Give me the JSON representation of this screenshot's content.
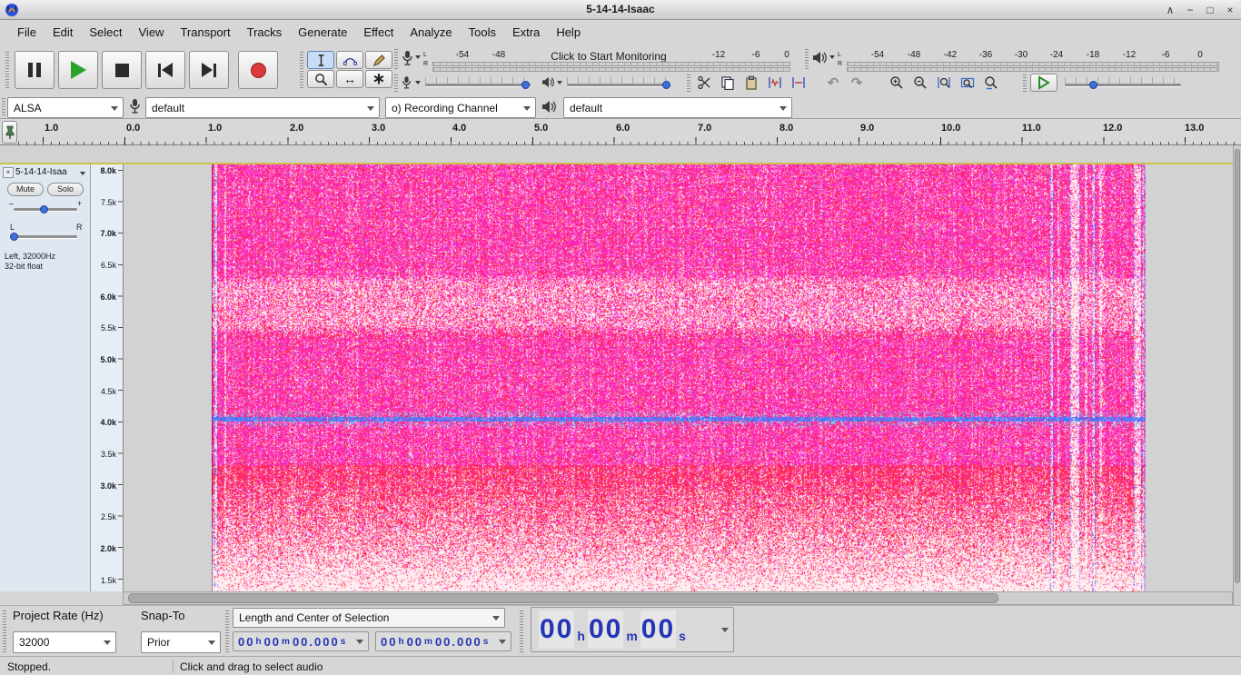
{
  "titlebar": {
    "title": "5-14-14-Isaac",
    "shade": "∧",
    "minimize": "−",
    "maximize": "□",
    "close": "×"
  },
  "menus": [
    "File",
    "Edit",
    "Select",
    "View",
    "Transport",
    "Tracks",
    "Generate",
    "Effect",
    "Analyze",
    "Tools",
    "Extra",
    "Help"
  ],
  "tools": {
    "timeshift": "↔",
    "multi": "∗"
  },
  "edit_icons": {
    "undo": "↶",
    "redo": "↷"
  },
  "recording_meter": {
    "channel_left": "L",
    "channel_right": "R",
    "ticks": [
      "-54",
      "-48",
      "-12",
      "-6",
      "0"
    ],
    "monitor_text": "Click to Start Monitoring"
  },
  "playback_meter": {
    "channel_left": "L",
    "channel_right": "R",
    "ticks": [
      "-54",
      "-48",
      "-42",
      "-36",
      "-30",
      "-24",
      "-18",
      "-12",
      "-6",
      "0"
    ]
  },
  "device": {
    "host": "ALSA",
    "recording_device": "default",
    "recording_channels": "o) Recording Channel",
    "playback_device": "default"
  },
  "timeline": {
    "labels": [
      "1.0",
      "0.0",
      "1.0",
      "2.0",
      "3.0",
      "4.0",
      "5.0",
      "6.0",
      "7.0",
      "8.0",
      "9.0",
      "10.0",
      "11.0",
      "12.0",
      "13.0"
    ]
  },
  "track": {
    "name": "5-14-14-Isaa",
    "mute": "Mute",
    "solo": "Solo",
    "gain_minus": "–",
    "gain_plus": "+",
    "pan_left": "L",
    "pan_right": "R",
    "info_format": "Left, 32000Hz",
    "info_depth": "32-bit float",
    "freq_labels": [
      "8.0k",
      "7.5k",
      "7.0k",
      "6.5k",
      "6.0k",
      "5.5k",
      "5.0k",
      "4.5k",
      "4.0k",
      "3.5k",
      "3.0k",
      "2.5k",
      "2.0k",
      "1.5k"
    ]
  },
  "selection_toolbar": {
    "project_rate_label": "Project Rate (Hz)",
    "project_rate": "32000",
    "snap_label": "Snap-To",
    "snap_value": "Prior",
    "mode": "Length and Center of Selection",
    "units": {
      "h": "h",
      "m": "m",
      "s": "s"
    },
    "start": {
      "h": "00",
      "m": "00",
      "s": "00.000"
    },
    "center": {
      "h": "00",
      "m": "00",
      "s": "00.000"
    },
    "audio_position": {
      "h": "00",
      "m": "00",
      "s": "00"
    }
  },
  "status": {
    "state": "Stopped.",
    "message": "Click and drag to select audio"
  },
  "spectrogram": {
    "base_magenta": "#f8109e",
    "magenta2": "#ff2ee2",
    "red": "#ff1e3c",
    "pink": "#ff82c8",
    "blue_line": "#3c64ff",
    "cyan": "#5ac8ff",
    "background": "#fff3f6"
  }
}
